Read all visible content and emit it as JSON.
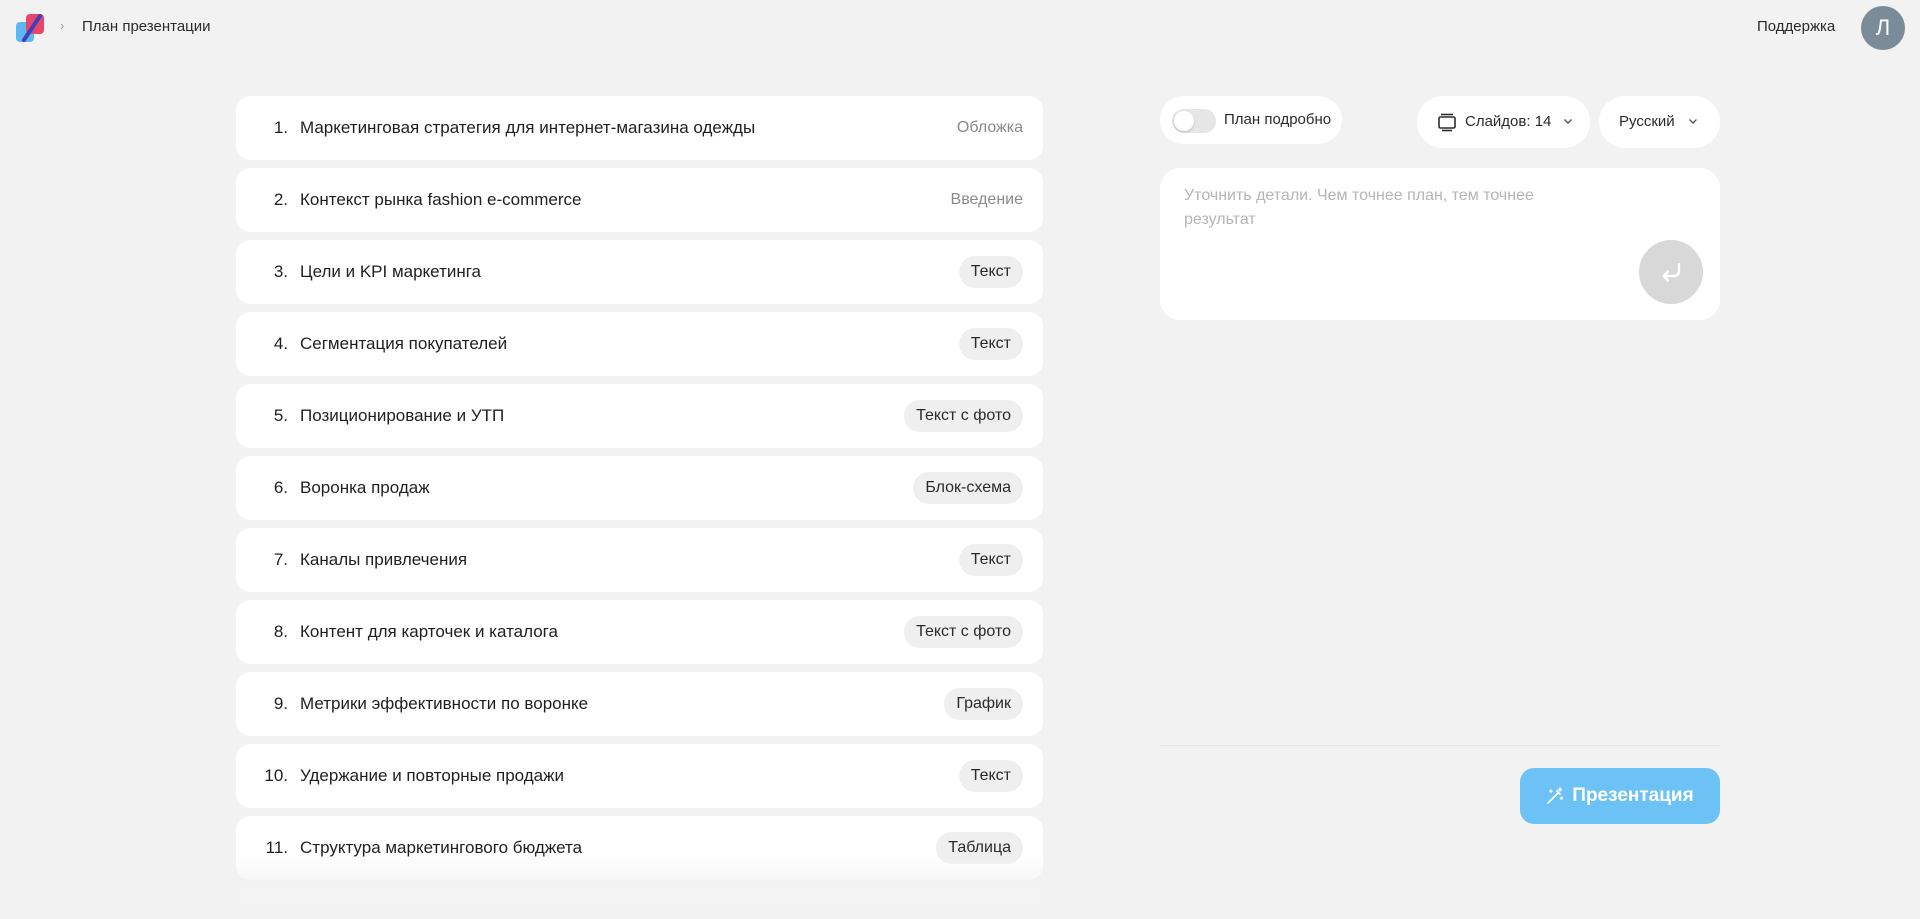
{
  "header": {
    "breadcrumb": "План презентации",
    "support_label": "Поддержка",
    "avatar_initial": "Л"
  },
  "slides": [
    {
      "num": "1.",
      "title": "Маркетинговая стратегия для интернет-магазина одежды",
      "type": "Обложка",
      "pill": false
    },
    {
      "num": "2.",
      "title": "Контекст рынка fashion e-commerce",
      "type": "Введение",
      "pill": false
    },
    {
      "num": "3.",
      "title": "Цели и KPI маркетинга",
      "type": "Текст",
      "pill": true
    },
    {
      "num": "4.",
      "title": "Сегментация покупателей",
      "type": "Текст",
      "pill": true
    },
    {
      "num": "5.",
      "title": "Позиционирование и УТП",
      "type": "Текст с фото",
      "pill": true
    },
    {
      "num": "6.",
      "title": "Воронка продаж",
      "type": "Блок-схема",
      "pill": true
    },
    {
      "num": "7.",
      "title": "Каналы привлечения",
      "type": "Текст",
      "pill": true
    },
    {
      "num": "8.",
      "title": "Контент для карточек и каталога",
      "type": "Текст с фото",
      "pill": true
    },
    {
      "num": "9.",
      "title": "Метрики эффективности по воронке",
      "type": "График",
      "pill": true
    },
    {
      "num": "10.",
      "title": "Удержание и повторные продажи",
      "type": "Текст",
      "pill": true
    },
    {
      "num": "11.",
      "title": "Структура маркетингового бюджета",
      "type": "Таблица",
      "pill": true
    }
  ],
  "panel": {
    "toggle_label": "План подробно",
    "toggle_on": false,
    "slides_count_label": "Слайдов: 14",
    "language_label": "Русский",
    "prompt_placeholder": "Уточнить детали. Чем точнее план, тем точнее результат",
    "prompt_value": "",
    "present_label": "Презентация"
  },
  "colors": {
    "background": "#f2f2f2",
    "accent": "#6cc2f4",
    "avatar": "#7a8c99",
    "logo_red": "#e8456b",
    "logo_blue": "#5bb8f0"
  }
}
